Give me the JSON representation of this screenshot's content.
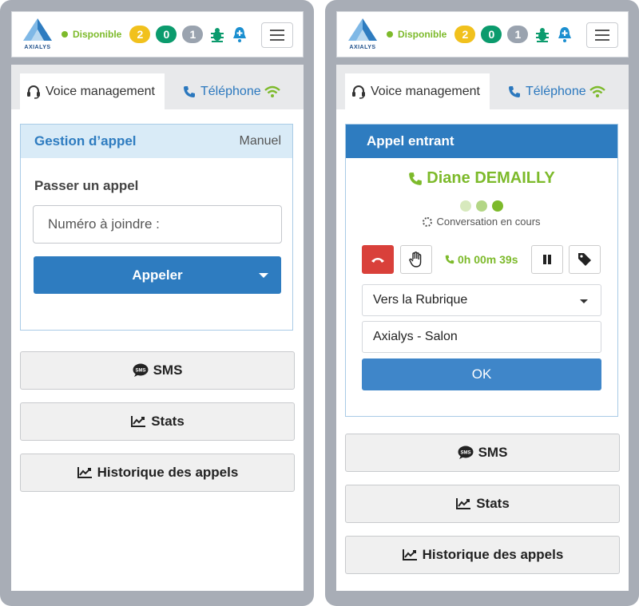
{
  "header": {
    "logo_text": "AXIALYS",
    "status": "Disponible",
    "status_color": "#7dba2b",
    "badges": [
      {
        "value": "2",
        "color": "#f1c11d"
      },
      {
        "value": "0",
        "color": "#0b9b6d"
      },
      {
        "value": "1",
        "color": "#9aa3af"
      }
    ],
    "icons": [
      "bug-icon",
      "bell-plus-icon",
      "hamburger-menu-icon"
    ]
  },
  "tabs": {
    "voice": "Voice management",
    "phone": "Téléphone"
  },
  "left": {
    "card_title": "Gestion d’appel",
    "card_mode": "Manuel",
    "section_label": "Passer un appel",
    "number_placeholder": "Numéro à joindre :",
    "call_button": "Appeler"
  },
  "right": {
    "card_title": "Appel entrant",
    "caller_name": "Diane DEMAILLY",
    "conversation_status": "Conversation en cours",
    "timer": "0h 00m 39s",
    "transfer_select": "Vers la Rubrique",
    "transfer_value": "Axialys - Salon",
    "ok_button": "OK"
  },
  "buttons": {
    "sms": "SMS",
    "stats": "Stats",
    "history": "Historique des appels"
  },
  "colors": {
    "primary": "#2e7cc0",
    "accent_green": "#7dba2b",
    "hangup_red": "#d9403a"
  }
}
